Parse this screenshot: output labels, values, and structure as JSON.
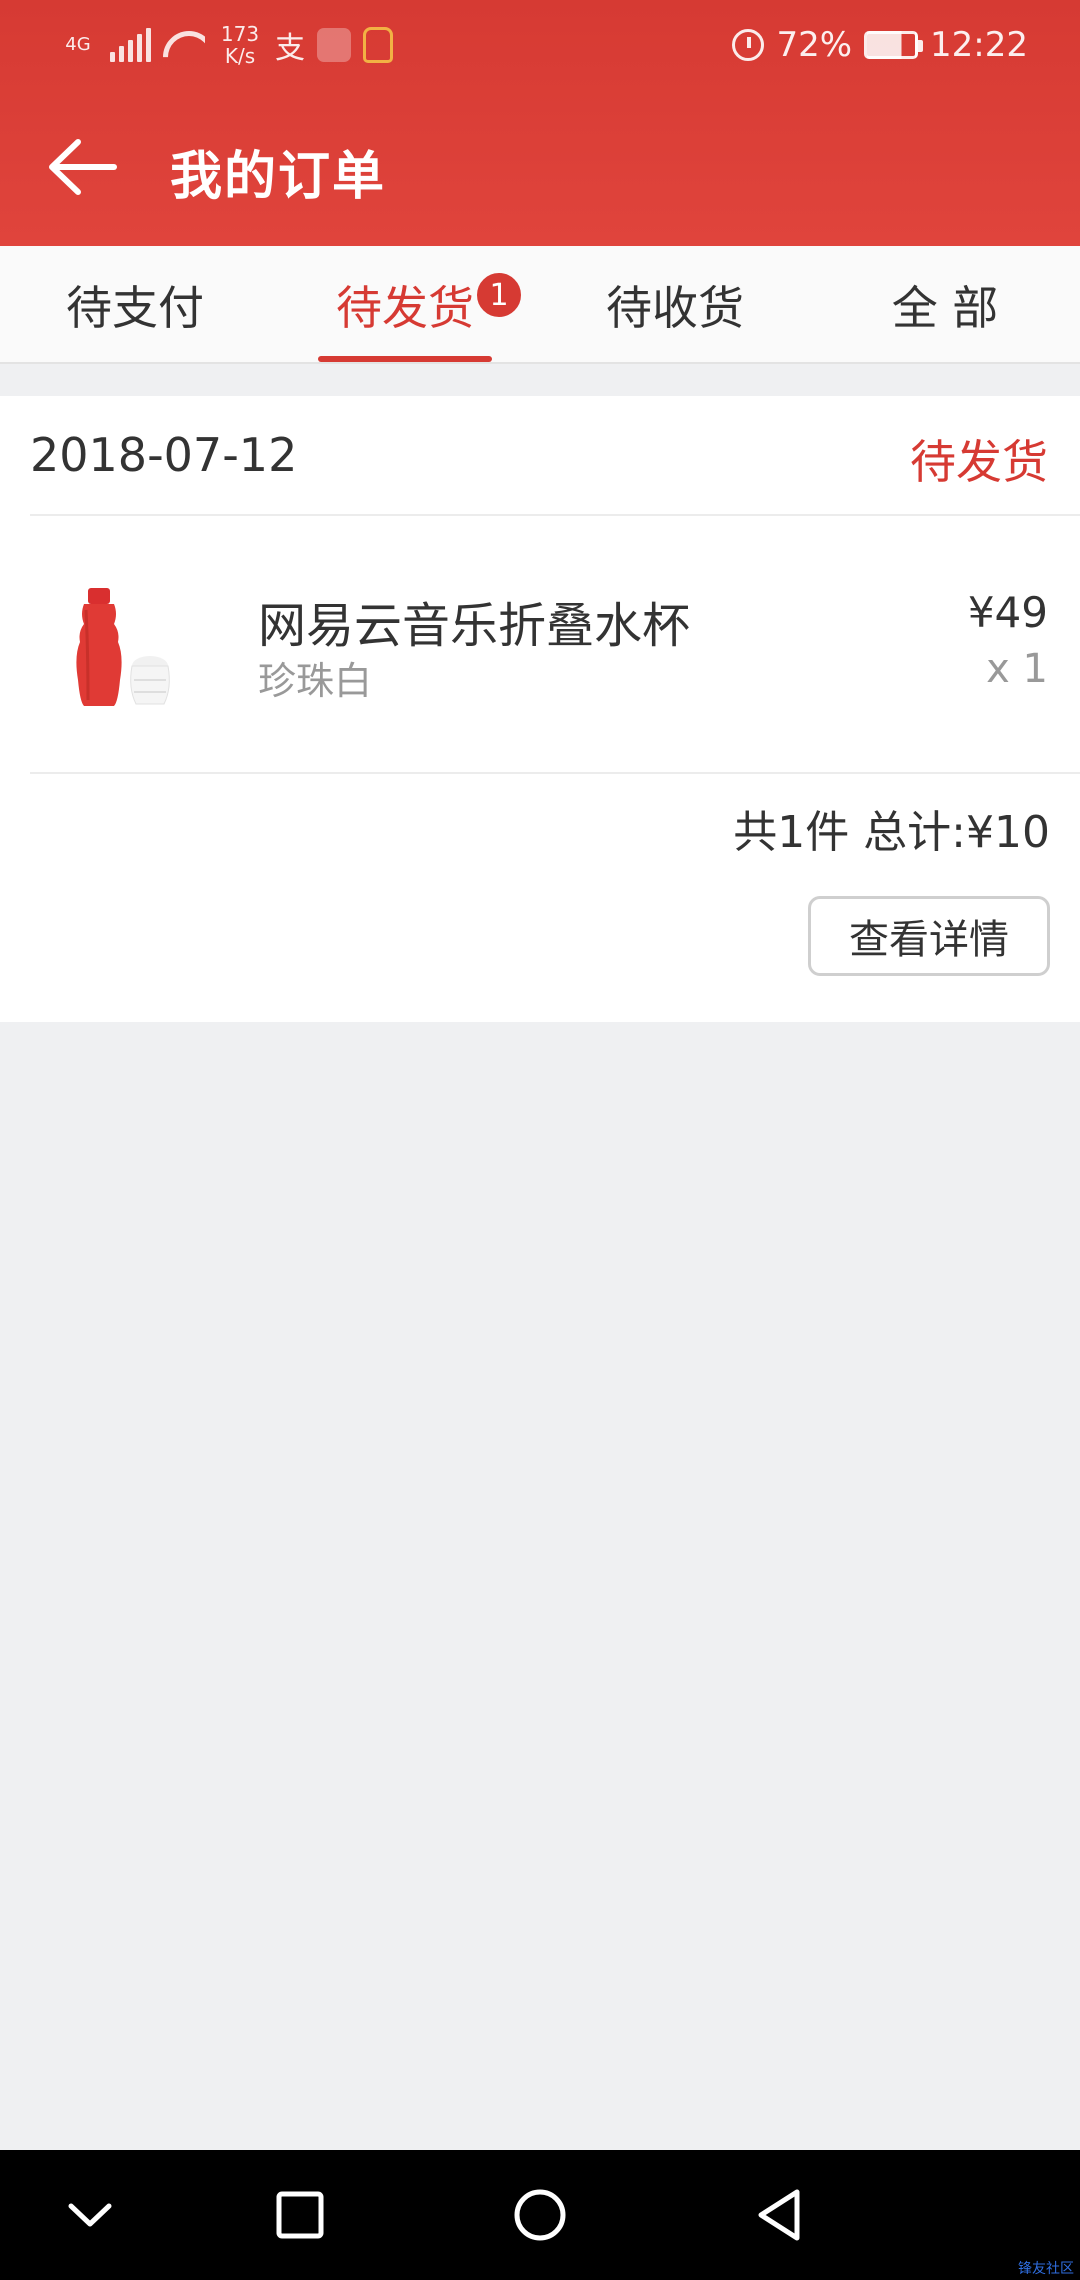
{
  "status_bar": {
    "network": "4G",
    "speed": "173\nK/s",
    "alarm_icon": "alarm-icon",
    "battery_percent": "72%",
    "battery_level": 0.72,
    "time": "12:22"
  },
  "appbar": {
    "title": "我的订单",
    "back_icon": "arrow-left-icon"
  },
  "tabs": {
    "items": [
      {
        "label": "待支付"
      },
      {
        "label": "待发货"
      },
      {
        "label": "待收货"
      },
      {
        "label": "全 部"
      }
    ],
    "active_index": 1,
    "badge": "1"
  },
  "order": {
    "date": "2018-07-12",
    "status": "待发货",
    "product": {
      "name": "网易云音乐折叠水杯",
      "variant": "珍珠白",
      "price": "¥49",
      "quantity": "x 1"
    },
    "summary": "共1件 总计:¥10",
    "details_button": "查看详情"
  },
  "colors": {
    "brand_red": "#d63a33",
    "background": "#eff0f2"
  },
  "navbar": {
    "icons": [
      "chevron-down-icon",
      "square-icon",
      "circle-home-icon",
      "triangle-back-icon"
    ]
  },
  "watermark": "锋友社区"
}
